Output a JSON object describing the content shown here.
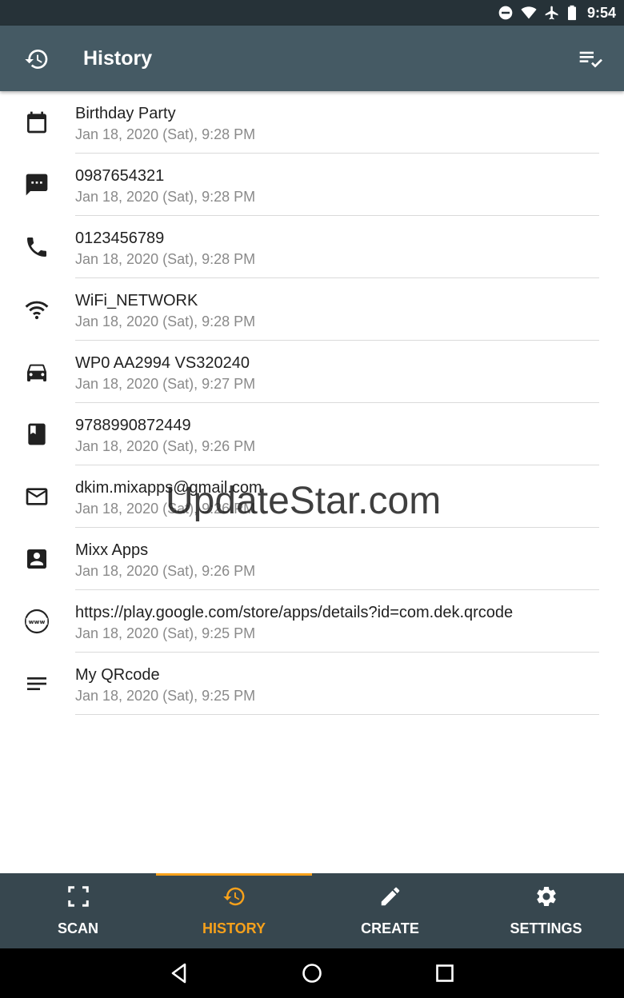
{
  "status_bar": {
    "time": "9:54",
    "icons": [
      "do-not-disturb-icon",
      "wifi-icon",
      "airplane-mode-icon",
      "battery-icon"
    ]
  },
  "app_bar": {
    "title": "History",
    "nav_icon": "history-icon",
    "action_icon": "select-all-icon"
  },
  "history": [
    {
      "title": "Birthday Party",
      "date": "Jan 18, 2020 (Sat), 9:28 PM",
      "icon": "calendar-icon"
    },
    {
      "title": "0987654321",
      "date": "Jan 18, 2020 (Sat), 9:28 PM",
      "icon": "sms-icon"
    },
    {
      "title": "0123456789",
      "date": "Jan 18, 2020 (Sat), 9:28 PM",
      "icon": "phone-icon"
    },
    {
      "title": "WiFi_NETWORK",
      "date": "Jan 18, 2020 (Sat), 9:28 PM",
      "icon": "wifi-icon"
    },
    {
      "title": "WP0 AA2994 VS320240",
      "date": "Jan 18, 2020 (Sat), 9:27 PM",
      "icon": "car-icon"
    },
    {
      "title": "9788990872449",
      "date": "Jan 18, 2020 (Sat), 9:26 PM",
      "icon": "book-icon"
    },
    {
      "title": "dkim.mixapps@gmail.com",
      "date": "Jan 18, 2020 (Sat), 9:26 PM",
      "icon": "email-icon"
    },
    {
      "title": "Mixx Apps",
      "date": "Jan 18, 2020 (Sat), 9:26 PM",
      "icon": "contact-icon"
    },
    {
      "title": "https://play.google.com/store/apps/details?id=com.dek.qrcode",
      "date": "Jan 18, 2020 (Sat), 9:25 PM",
      "icon": "web-icon"
    },
    {
      "title": "My QRcode",
      "date": "Jan 18, 2020 (Sat), 9:25 PM",
      "icon": "text-icon"
    }
  ],
  "watermark": "UpdateStar.com",
  "bottom_nav": {
    "active_tab": "history",
    "active_color": "#f7a11b",
    "tabs": [
      {
        "key": "scan",
        "label": "SCAN",
        "icon": "scan-icon"
      },
      {
        "key": "history",
        "label": "HISTORY",
        "icon": "history-icon"
      },
      {
        "key": "create",
        "label": "CREATE",
        "icon": "pencil-icon"
      },
      {
        "key": "settings",
        "label": "SETTINGS",
        "icon": "gear-icon"
      }
    ]
  },
  "system_nav": {
    "buttons": [
      "back-icon",
      "home-icon",
      "recents-icon"
    ]
  },
  "colors": {
    "status_bar": "#263238",
    "app_bar": "#455a64",
    "bottom_nav": "#37474f",
    "accent": "#f7a11b"
  }
}
